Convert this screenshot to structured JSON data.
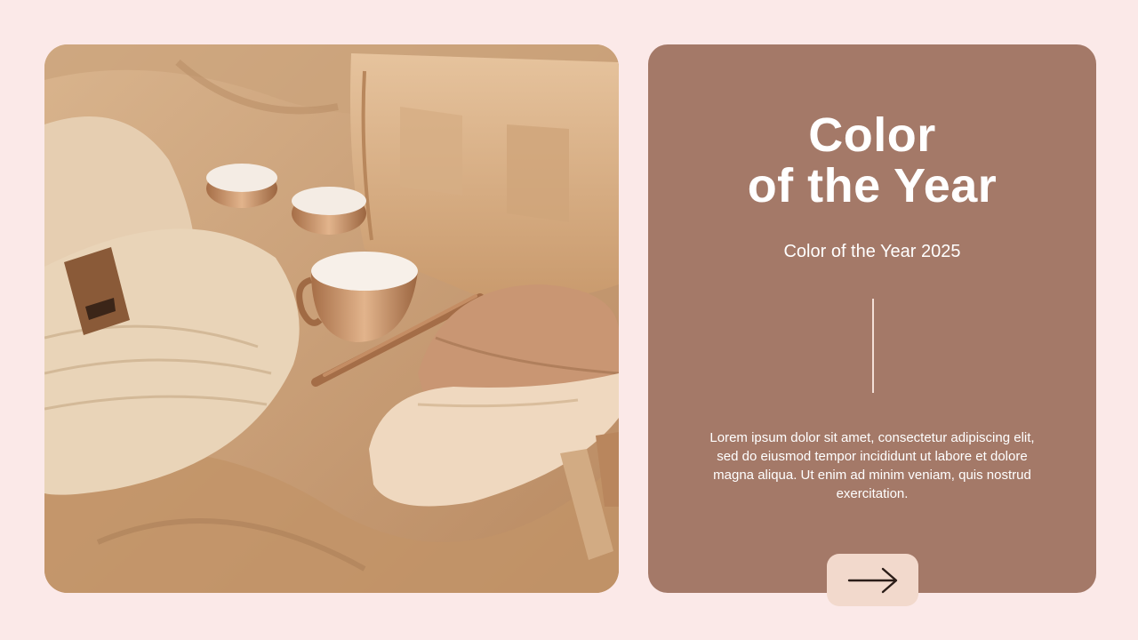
{
  "page": {
    "background_color": "#fbe9e8"
  },
  "photo": {
    "description_icon": "fashion-accessories-photo"
  },
  "card": {
    "background_color": "#a47968",
    "title_line_1": "Color",
    "title_line_2": "of the Year",
    "subtitle": "Color of the Year 2025",
    "body": "Lorem ipsum dolor sit amet, consectetur adipiscing elit, sed do eiusmod tempor incididunt ut labore et dolore magna aliqua. Ut enim ad minim veniam, quis nostrud exercitation.",
    "button_icon": "arrow-right-icon",
    "button_color": "#f2d9cc"
  }
}
